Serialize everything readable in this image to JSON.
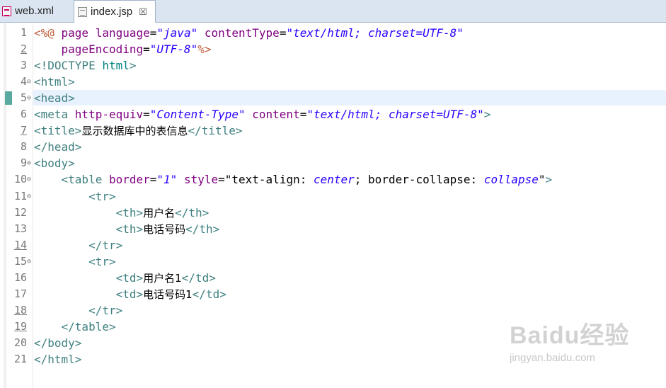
{
  "tabs": [
    {
      "label": "web.xml",
      "icon": "xml-file-icon",
      "active": false
    },
    {
      "label": "index.jsp",
      "icon": "jsp-file-icon",
      "active": true,
      "close": "☒"
    }
  ],
  "lines": [
    {
      "n": "1",
      "fold": "",
      "ul": false,
      "tokens": [
        [
          "jd",
          "<%@ "
        ],
        [
          "at",
          "page "
        ],
        [
          "at",
          "language"
        ],
        [
          "tx",
          "="
        ],
        [
          "st",
          "\"java\""
        ],
        [
          "tx",
          " "
        ],
        [
          "at",
          "contentType"
        ],
        [
          "tx",
          "="
        ],
        [
          "st",
          "\"text/html; charset=UTF-8\""
        ]
      ]
    },
    {
      "n": "2",
      "fold": "",
      "ul": true,
      "tokens": [
        [
          "tx",
          "    "
        ],
        [
          "at",
          "pageEncoding"
        ],
        [
          "tx",
          "="
        ],
        [
          "st",
          "\"UTF-8\""
        ],
        [
          "jd",
          "%>"
        ]
      ]
    },
    {
      "n": "3",
      "fold": "",
      "ul": false,
      "tokens": [
        [
          "tg",
          "<!DOCTYPE "
        ],
        [
          "dt",
          "html"
        ],
        [
          "tg",
          ">"
        ]
      ]
    },
    {
      "n": "4",
      "fold": "⊖",
      "ul": false,
      "tokens": [
        [
          "tg",
          "<html>"
        ]
      ]
    },
    {
      "n": "5",
      "fold": "⊖",
      "ul": false,
      "tokens": [
        [
          "tg",
          "<head>"
        ]
      ]
    },
    {
      "n": "6",
      "fold": "",
      "ul": false,
      "tokens": [
        [
          "tg",
          "<meta "
        ],
        [
          "at",
          "http-equiv"
        ],
        [
          "tx",
          "="
        ],
        [
          "st",
          "\"Content-Type\""
        ],
        [
          "tx",
          " "
        ],
        [
          "at",
          "content"
        ],
        [
          "tx",
          "="
        ],
        [
          "st",
          "\"text/html; charset=UTF-8\""
        ],
        [
          "tg",
          ">"
        ]
      ]
    },
    {
      "n": "7",
      "fold": "",
      "ul": true,
      "tokens": [
        [
          "tg",
          "<title>"
        ],
        [
          "cn",
          "显示数据库中的表信息"
        ],
        [
          "tg",
          "</title>"
        ]
      ]
    },
    {
      "n": "8",
      "fold": "",
      "ul": false,
      "tokens": [
        [
          "tg",
          "</head>"
        ]
      ]
    },
    {
      "n": "9",
      "fold": "⊖",
      "ul": false,
      "tokens": [
        [
          "tg",
          "<body>"
        ]
      ]
    },
    {
      "n": "10",
      "fold": "⊖",
      "ul": false,
      "tokens": [
        [
          "tx",
          "    "
        ],
        [
          "tg",
          "<table "
        ],
        [
          "at",
          "border"
        ],
        [
          "tx",
          "="
        ],
        [
          "st",
          "\"1\""
        ],
        [
          "tx",
          " "
        ],
        [
          "at",
          "style"
        ],
        [
          "tx",
          "=\"text-align: "
        ],
        [
          "st",
          "center"
        ],
        [
          "tx",
          "; border-collapse: "
        ],
        [
          "st",
          "collapse"
        ],
        [
          "tx",
          "\""
        ],
        [
          "tg",
          ">"
        ]
      ]
    },
    {
      "n": "11",
      "fold": "⊖",
      "ul": false,
      "tokens": [
        [
          "tx",
          "        "
        ],
        [
          "tg",
          "<tr>"
        ]
      ]
    },
    {
      "n": "12",
      "fold": "",
      "ul": false,
      "tokens": [
        [
          "tx",
          "            "
        ],
        [
          "tg",
          "<th>"
        ],
        [
          "cn",
          "用户名"
        ],
        [
          "tg",
          "</th>"
        ]
      ]
    },
    {
      "n": "13",
      "fold": "",
      "ul": false,
      "tokens": [
        [
          "tx",
          "            "
        ],
        [
          "tg",
          "<th>"
        ],
        [
          "cn",
          "电话号码"
        ],
        [
          "tg",
          "</th>"
        ]
      ]
    },
    {
      "n": "14",
      "fold": "",
      "ul": true,
      "tokens": [
        [
          "tx",
          "        "
        ],
        [
          "tg",
          "</tr>"
        ]
      ]
    },
    {
      "n": "15",
      "fold": "⊖",
      "ul": false,
      "tokens": [
        [
          "tx",
          "        "
        ],
        [
          "tg",
          "<tr>"
        ]
      ]
    },
    {
      "n": "16",
      "fold": "",
      "ul": false,
      "tokens": [
        [
          "tx",
          "            "
        ],
        [
          "tg",
          "<td>"
        ],
        [
          "cn",
          "用户名1"
        ],
        [
          "tg",
          "</td>"
        ]
      ]
    },
    {
      "n": "17",
      "fold": "",
      "ul": false,
      "tokens": [
        [
          "tx",
          "            "
        ],
        [
          "tg",
          "<td>"
        ],
        [
          "cn",
          "电话号码1"
        ],
        [
          "tg",
          "</td>"
        ]
      ]
    },
    {
      "n": "18",
      "fold": "",
      "ul": true,
      "tokens": [
        [
          "tx",
          "        "
        ],
        [
          "tg",
          "</tr>"
        ]
      ]
    },
    {
      "n": "19",
      "fold": "",
      "ul": true,
      "tokens": [
        [
          "tx",
          "    "
        ],
        [
          "tg",
          "</table>"
        ]
      ]
    },
    {
      "n": "20",
      "fold": "",
      "ul": false,
      "tokens": [
        [
          "tg",
          "</body>"
        ]
      ]
    },
    {
      "n": "21",
      "fold": "",
      "ul": false,
      "tokens": [
        [
          "tg",
          "</html>"
        ]
      ]
    }
  ],
  "watermark": {
    "logo": "Baidu经验",
    "url": "jingyan.baidu.com"
  },
  "colors": {
    "tag": "#3f7f7f",
    "attr": "#7f007f",
    "string": "#2a00ff",
    "jsp": "#bf5f3f",
    "highlight": "#e8f2fe"
  }
}
